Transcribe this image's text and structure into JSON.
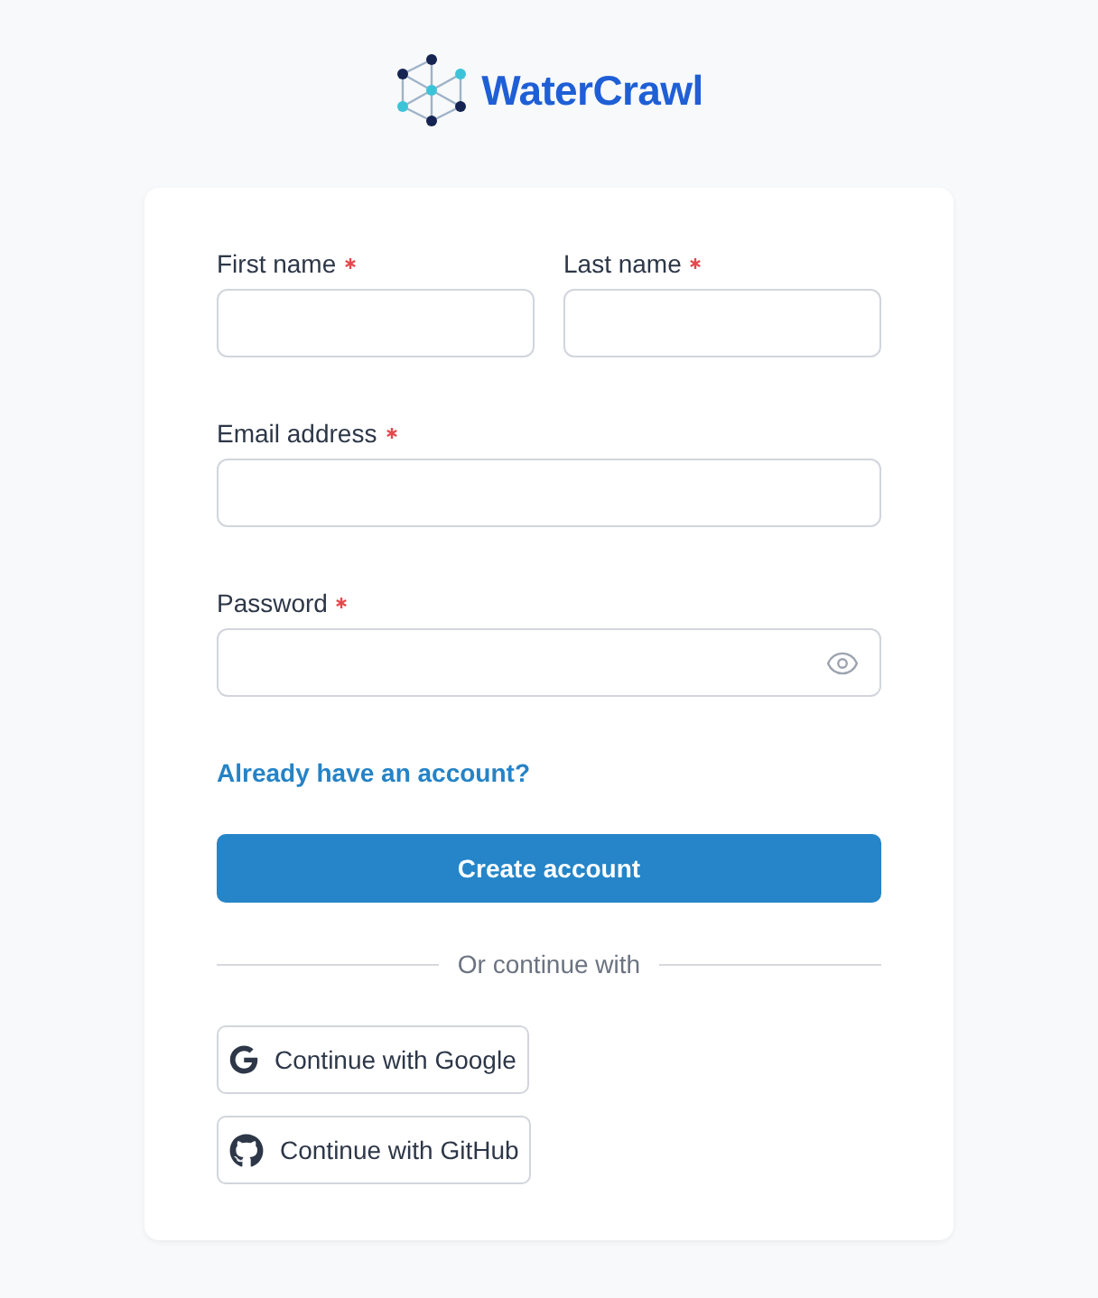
{
  "brand": {
    "name": "WaterCrawl"
  },
  "form": {
    "name_fields": [
      {
        "label": "First name",
        "required": true
      },
      {
        "label": "Last name",
        "required": true
      }
    ],
    "fields": [
      {
        "label": "Email address",
        "required": true,
        "kind": "text"
      },
      {
        "label": "Password",
        "required": true,
        "kind": "password"
      }
    ],
    "login_link": "Already have an account?",
    "submit": "Create account",
    "divider": "Or continue with",
    "social": [
      {
        "label": "Continue with Google",
        "kind": "google"
      },
      {
        "label": "Continue with GitHub",
        "kind": "github"
      }
    ]
  }
}
